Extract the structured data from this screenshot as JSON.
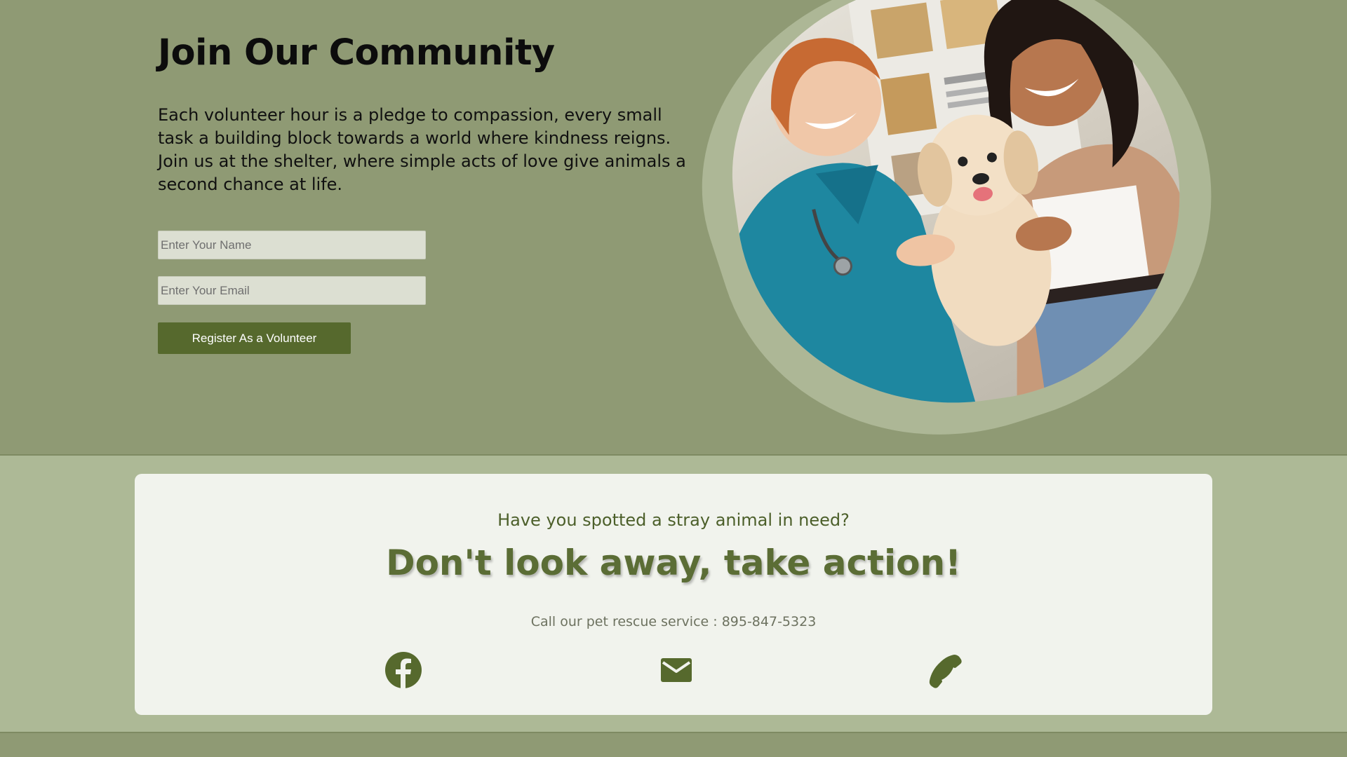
{
  "join": {
    "title": "Join Our Community",
    "text": "Each volunteer hour is a pledge to compassion, every small task a building block towards a world where kindness reigns. Join us at the shelter, where simple acts of love give animals a second chance at life.",
    "name_placeholder": "Enter Your Name",
    "email_placeholder": "Enter Your Email",
    "register_label": "Register As a Volunteer"
  },
  "stray": {
    "question": "Have you spotted a stray animal in need?",
    "cta": "Don't look away, take action!",
    "phone_text": "Call our pet rescue service : 895-847-5323",
    "icons": [
      "facebook-icon",
      "mail-icon",
      "phone-icon"
    ]
  },
  "colors": {
    "section_bg": "#8f9a74",
    "stray_bg": "#adb996",
    "card_bg": "#f1f3ed",
    "accent": "#56692d",
    "cta_text": "#5b6d35"
  }
}
